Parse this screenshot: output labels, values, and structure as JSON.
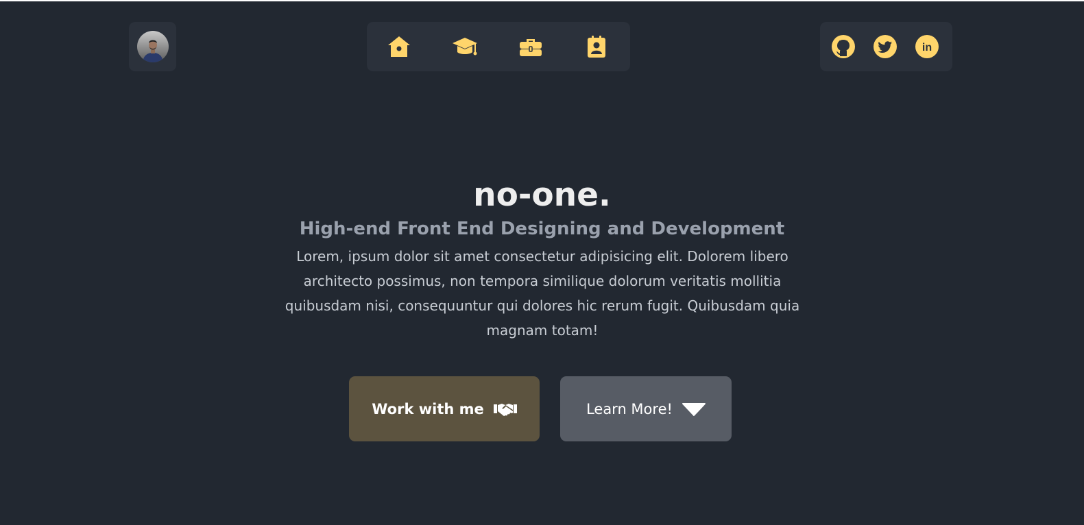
{
  "header": {
    "nav_items": [
      {
        "name": "home",
        "icon": "home-icon"
      },
      {
        "name": "education",
        "icon": "graduation-cap-icon"
      },
      {
        "name": "work",
        "icon": "briefcase-icon"
      },
      {
        "name": "contact",
        "icon": "contact-card-icon"
      }
    ],
    "social_links": [
      {
        "name": "github",
        "icon": "github-icon"
      },
      {
        "name": "twitter",
        "icon": "twitter-icon"
      },
      {
        "name": "linkedin",
        "icon": "linkedin-icon",
        "label": "in"
      }
    ]
  },
  "hero": {
    "name": "no-one.",
    "subtitle": "High-end Front End Designing and Development",
    "description": "Lorem, ipsum dolor sit amet consectetur adipisicing elit. Dolorem libero architecto possimus, non tempora similique dolorum veritatis mollitia quibusdam nisi, consequuntur qui dolores hic rerum fugit. Quibusdam quia magnam totam!",
    "primary_button": {
      "label": "Work with me",
      "icon": "handshake-icon"
    },
    "secondary_button": {
      "label": "Learn More!",
      "icon": "caret-down-icon"
    }
  },
  "colors": {
    "background": "#222831",
    "panel": "#2b313b",
    "accent": "#ffd56b",
    "primary_button": "#5c533f",
    "secondary_button": "#575c65"
  }
}
